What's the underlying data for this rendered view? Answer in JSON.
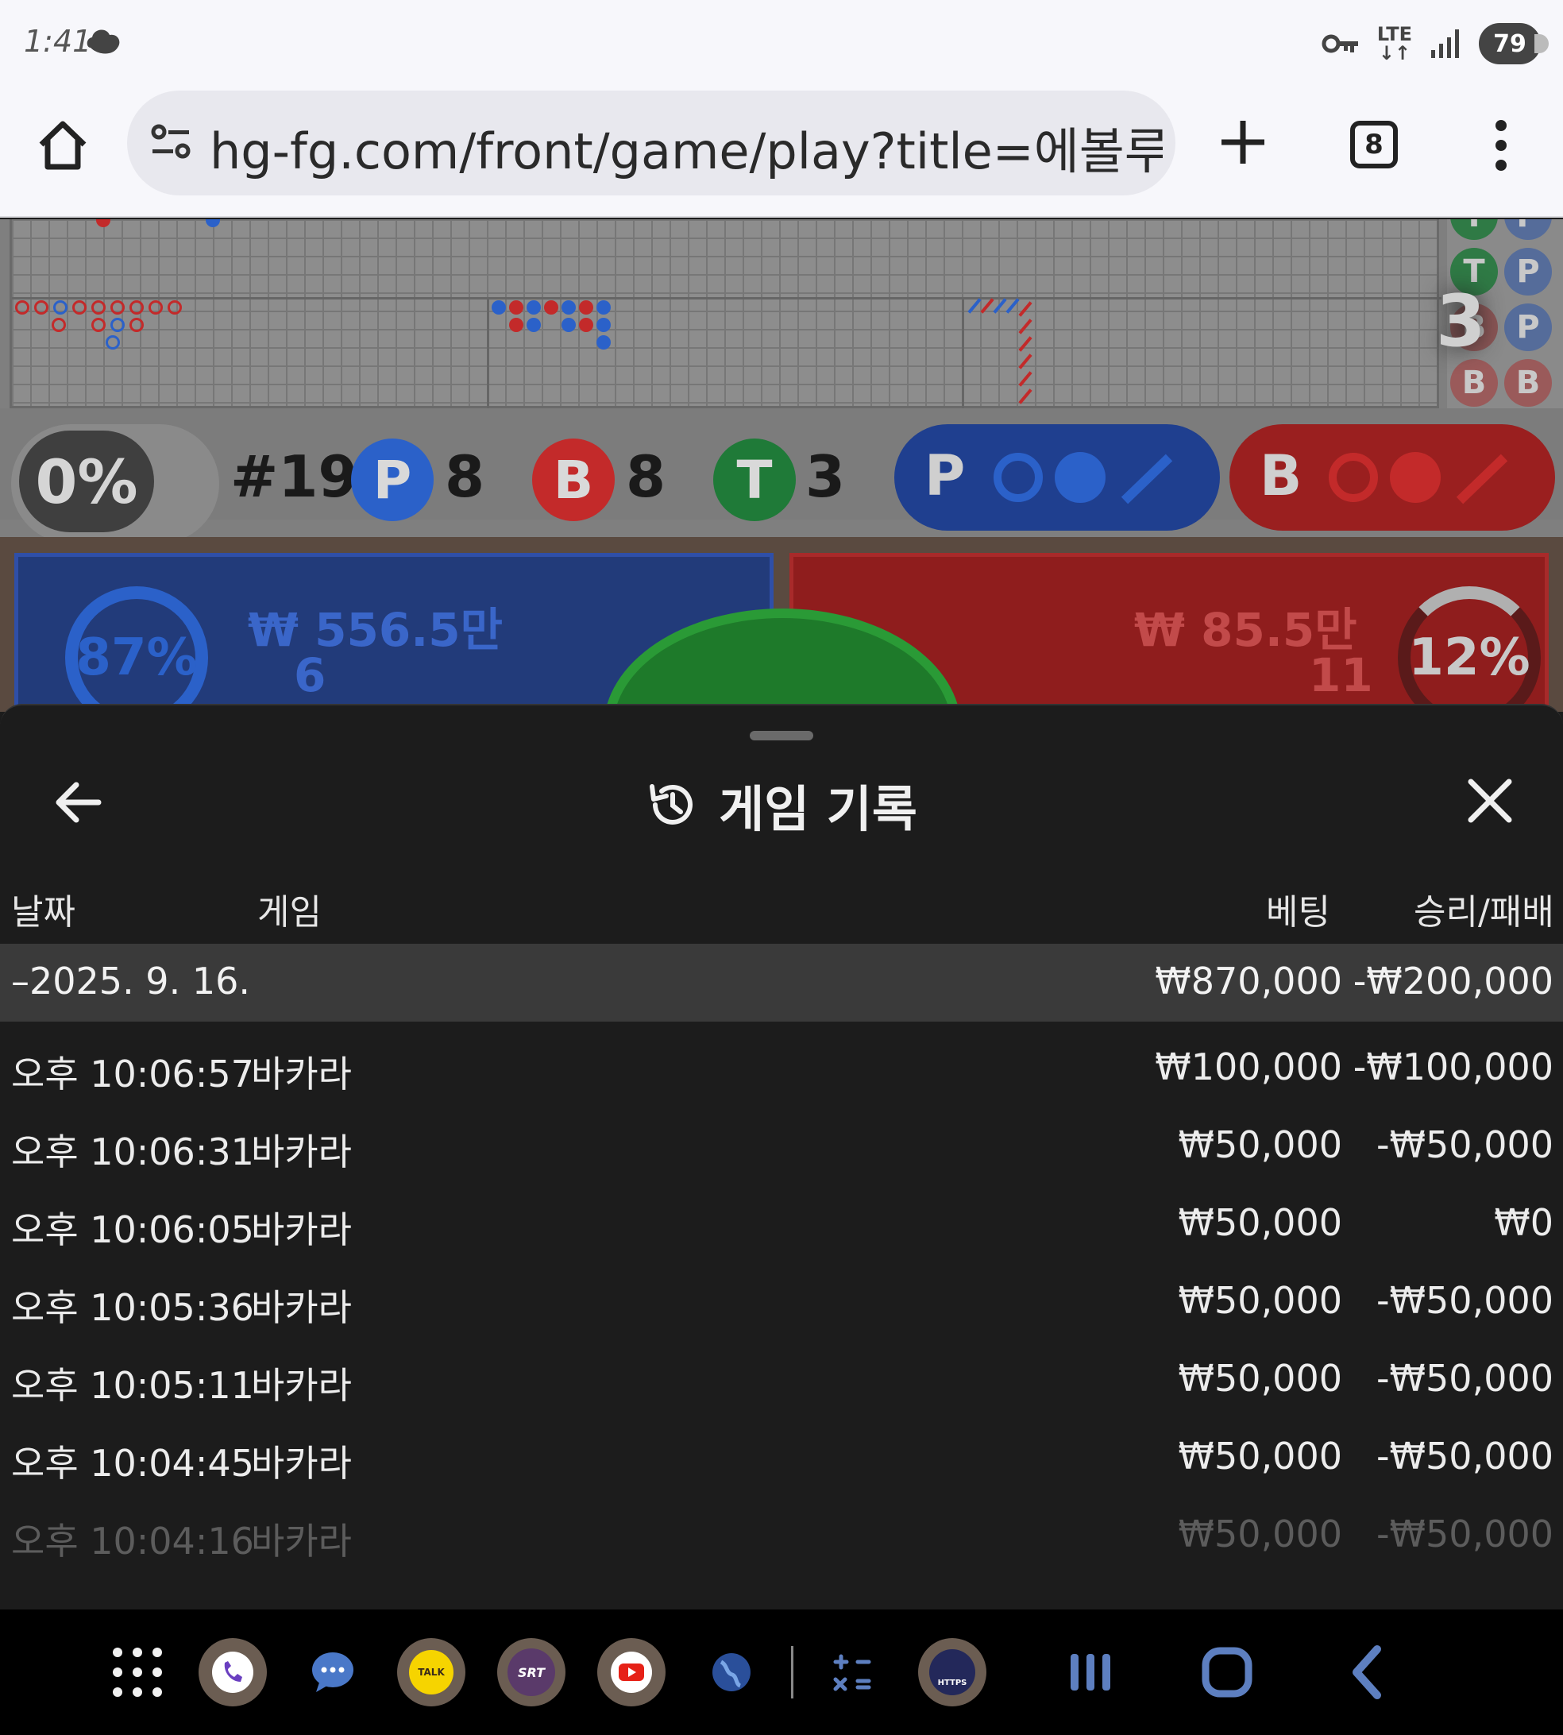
{
  "status_bar": {
    "time": "1:41",
    "network_label": "LTE",
    "battery": "79"
  },
  "browser": {
    "url": "hg-fg.com/front/game/play?title=에볼루션",
    "tab_count": "8"
  },
  "game": {
    "percent_pill": "0%",
    "round_label": "#19",
    "player_badge": "P",
    "player_count": "8",
    "banker_badge": "B",
    "banker_count": "8",
    "tie_badge": "T",
    "tie_count": "3",
    "predict_player_label": "P",
    "predict_banker_label": "B",
    "side_big_number": "3",
    "player_bet_amount": "₩ 556.5만",
    "player_bet_percent": "87%",
    "player_bet_count": "6",
    "banker_bet_amount": "₩ 85.5만",
    "banker_bet_percent": "12%",
    "banker_bet_count": "11"
  },
  "sheet": {
    "title": "게임 기록",
    "columns": {
      "date": "날짜",
      "game": "게임",
      "bet": "베팅",
      "result": "승리/패배"
    },
    "date_group": {
      "date": "–2025. 9. 16.",
      "bet_total": "₩870,000",
      "result_total": "-₩200,000"
    },
    "records": [
      {
        "time": "오후 10:06:57",
        "game": "바카라",
        "bet": "₩100,000",
        "result": "-₩100,000"
      },
      {
        "time": "오후 10:06:31",
        "game": "바카라",
        "bet": "₩50,000",
        "result": "-₩50,000"
      },
      {
        "time": "오후 10:06:05",
        "game": "바카라",
        "bet": "₩50,000",
        "result": "₩0"
      },
      {
        "time": "오후 10:05:36",
        "game": "바카라",
        "bet": "₩50,000",
        "result": "-₩50,000"
      },
      {
        "time": "오후 10:05:11",
        "game": "바카라",
        "bet": "₩50,000",
        "result": "-₩50,000"
      },
      {
        "time": "오후 10:04:45",
        "game": "바카라",
        "bet": "₩50,000",
        "result": "-₩50,000"
      },
      {
        "time": "오후 10:04:16",
        "game": "바카라",
        "bet": "₩50,000",
        "result": "-₩50,000"
      }
    ]
  },
  "navbar": {
    "kakao_label": "TALK",
    "srt_label": "SRT",
    "https_label": "HTTPS"
  },
  "colors": {
    "player_blue": "#2b61c9",
    "banker_red": "#c32a2a",
    "tie_green": "#1f8a3a",
    "sheet_bg": "#1c1c1c"
  }
}
